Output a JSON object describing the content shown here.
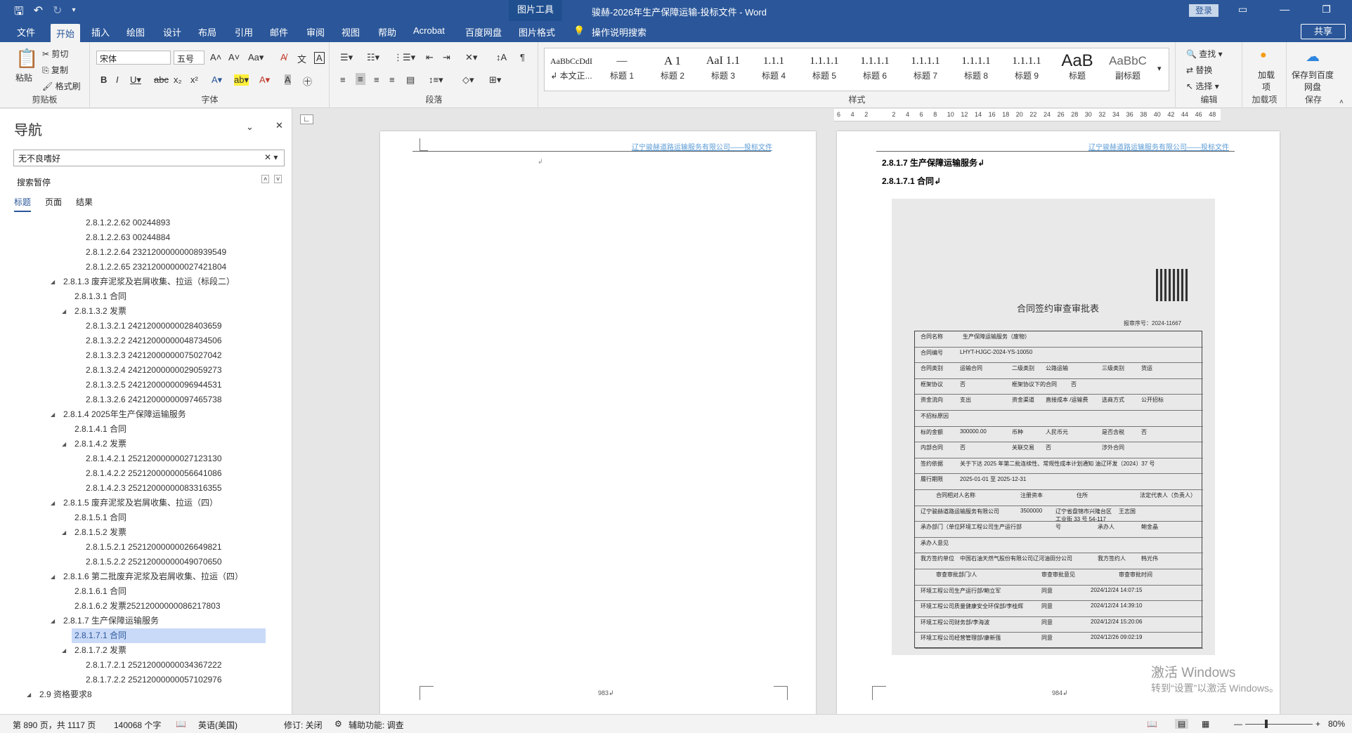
{
  "window": {
    "title": "骏赫-2026年生产保障运输-投标文件 - Word",
    "context_tab": "图片工具",
    "login": "登录"
  },
  "tabs": [
    "文件",
    "开始",
    "插入",
    "绘图",
    "设计",
    "布局",
    "引用",
    "邮件",
    "审阅",
    "视图",
    "帮助",
    "Acrobat",
    "百度网盘",
    "图片格式"
  ],
  "active_tab": "开始",
  "tell_me": "操作说明搜索",
  "share": "共享",
  "ribbon": {
    "clipboard": {
      "paste": "粘贴",
      "cut": "剪切",
      "copy": "复制",
      "format_painter": "格式刷",
      "label": "剪贴板"
    },
    "font": {
      "name": "宋体",
      "size": "五号",
      "label": "字体"
    },
    "paragraph": {
      "label": "段落"
    },
    "styles": {
      "label": "样式",
      "items": [
        {
          "sample": "AaBbCcDdI",
          "name": "↲ 本文正..."
        },
        {
          "sample": "—",
          "name": "标题 1"
        },
        {
          "sample": "A 1",
          "name": "标题 2"
        },
        {
          "sample": "AaI 1.1",
          "name": "标题 3"
        },
        {
          "sample": "1.1.1",
          "name": "标题 4"
        },
        {
          "sample": "1.1.1.1",
          "name": "标题 5"
        },
        {
          "sample": "1.1.1.1",
          "name": "标题 6"
        },
        {
          "sample": "1.1.1.1",
          "name": "标题 7"
        },
        {
          "sample": "1.1.1.1",
          "name": "标题 8"
        },
        {
          "sample": "1.1.1.1",
          "name": "标题 9"
        },
        {
          "sample": "AaB",
          "name": "标题"
        },
        {
          "sample": "AaBbC",
          "name": "副标题"
        }
      ]
    },
    "editing": {
      "find": "查找",
      "replace": "替换",
      "select": "选择",
      "label": "编辑"
    },
    "addins": {
      "btn": "加载项",
      "label": "加载项"
    },
    "save": {
      "btn": "保存到百度网盘",
      "label": "保存"
    }
  },
  "nav": {
    "title": "导航",
    "search": "无不良嗜好",
    "status": "搜索暂停",
    "tabs": [
      "标题",
      "页面",
      "结果"
    ],
    "items": [
      {
        "t": "2.8.1.2.2.62 00244893",
        "l": 4
      },
      {
        "t": "2.8.1.2.2.63 00244884",
        "l": 4
      },
      {
        "t": "2.8.1.2.2.64 23212000000008939549",
        "l": 4
      },
      {
        "t": "2.8.1.2.2.65 23212000000027421804",
        "l": 4
      },
      {
        "t": "2.8.1.3 废弃泥浆及岩屑收集、拉运（标段二）",
        "l": 2,
        "x": true
      },
      {
        "t": "2.8.1.3.1 合同",
        "l": 3
      },
      {
        "t": "2.8.1.3.2 发票",
        "l": 3,
        "x": true
      },
      {
        "t": "2.8.1.3.2.1 24212000000028403659",
        "l": 4
      },
      {
        "t": "2.8.1.3.2.2 24212000000048734506",
        "l": 4
      },
      {
        "t": "2.8.1.3.2.3 24212000000075027042",
        "l": 4
      },
      {
        "t": "2.8.1.3.2.4 24212000000029059273",
        "l": 4
      },
      {
        "t": "2.8.1.3.2.5 24212000000096944531",
        "l": 4
      },
      {
        "t": "2.8.1.3.2.6 24212000000097465738",
        "l": 4
      },
      {
        "t": "2.8.1.4 2025年生产保障运输服务",
        "l": 2,
        "x": true
      },
      {
        "t": "2.8.1.4.1 合同",
        "l": 3
      },
      {
        "t": "2.8.1.4.2 发票",
        "l": 3,
        "x": true
      },
      {
        "t": "2.8.1.4.2.1 25212000000027123130",
        "l": 4
      },
      {
        "t": "2.8.1.4.2.2 25212000000056641086",
        "l": 4
      },
      {
        "t": "2.8.1.4.2.3 25212000000083316355",
        "l": 4
      },
      {
        "t": "2.8.1.5 废弃泥浆及岩屑收集、拉运（四）",
        "l": 2,
        "x": true
      },
      {
        "t": "2.8.1.5.1 合同",
        "l": 3
      },
      {
        "t": "2.8.1.5.2 发票",
        "l": 3,
        "x": true
      },
      {
        "t": "2.8.1.5.2.1 25212000000026649821",
        "l": 4
      },
      {
        "t": "2.8.1.5.2.2 25212000000049070650",
        "l": 4
      },
      {
        "t": "2.8.1.6 第二批废弃泥浆及岩屑收集、拉运（四）",
        "l": 2,
        "x": true
      },
      {
        "t": "2.8.1.6.1 合同",
        "l": 3
      },
      {
        "t": "2.8.1.6.2 发票25212000000086217803",
        "l": 3
      },
      {
        "t": "2.8.1.7 生产保障运输服务",
        "l": 2,
        "x": true
      },
      {
        "t": "2.8.1.7.1 合同",
        "l": 3,
        "sel": true
      },
      {
        "t": "2.8.1.7.2 发票",
        "l": 3,
        "x": true
      },
      {
        "t": "2.8.1.7.2.1 25212000000034367222",
        "l": 4
      },
      {
        "t": "2.8.1.7.2.2 25212000000057102976",
        "l": 4
      },
      {
        "t": "2.9 资格要求8",
        "l": 1,
        "x": true
      }
    ]
  },
  "pages": {
    "header_text": "辽宁骏赫道路运输服务有限公司——投标文件",
    "left_no": "983↲",
    "right_no": "984↲",
    "h1": "2.8.1.7 生产保障运输服务↲",
    "h2": "2.8.1.7.1 合同↲"
  },
  "ruler_ticks": [
    "6",
    "4",
    "2",
    "",
    "2",
    "4",
    "6",
    "8",
    "10",
    "12",
    "14",
    "16",
    "18",
    "20",
    "22",
    "24",
    "26",
    "28",
    "30",
    "32",
    "34",
    "36",
    "38",
    "40",
    "42",
    "44",
    "46",
    "48"
  ],
  "scan": {
    "title": "合同签约审查审批表",
    "no": "报审序号：2024-11667",
    "rows": [
      [
        "合同名称",
        "生产保障运输服务（废物）"
      ],
      [
        "合同编号",
        "LHYT-HJGC-2024-YS-10050"
      ],
      [
        "合同类别",
        "运输合同",
        "二级类别",
        "公路运输",
        "三级类别",
        "货运"
      ],
      [
        "框架协议",
        "否",
        "框架协议下的合同",
        "否"
      ],
      [
        "资金流向",
        "支出",
        "资金渠道",
        "直接成本 /运输费",
        "选商方式",
        "公开招标"
      ],
      [
        "不招标原因",
        ""
      ],
      [
        "标的金额",
        "300000.00",
        "币种",
        "人民币元",
        "是否含税",
        "否"
      ],
      [
        "内部合同",
        "否",
        "关联交易",
        "否",
        "涉外合同",
        ""
      ],
      [
        "签约依据",
        "关于下达 2025 年第二批连续性、常规性成本计划通知 油辽环发〔2024〕37 号"
      ],
      [
        "履行期限",
        "2025-01-01 至 2025-12-31"
      ],
      [
        "合同相对人名称",
        "注册资本",
        "住所",
        "法定代表人（负责人）"
      ],
      [
        "辽宁骏赫道路运输服务有限公司",
        "3500000",
        "辽宁省盘锦市兴隆台区工业街 33 号 54-117 号",
        "王志国"
      ],
      [
        "承办部门（单位）",
        "环境工程公司生产运行部",
        "承办人",
        "鲍金晶"
      ],
      [
        "承办人意见",
        ""
      ],
      [
        "我方签约单位",
        "中国石油天然气股份有限公司辽河油田分公司",
        "我方签约人",
        "韩光伟"
      ],
      [
        "审查审批部门/人",
        "审查审批意见",
        "审查审批时间"
      ],
      [
        "环境工程公司生产运行部/鲍立军",
        "同意",
        "2024/12/24 14:07:15"
      ],
      [
        "环境工程公司质量健康安全环保部/李桂辉",
        "同意",
        "2024/12/24 14:39:10"
      ],
      [
        "环境工程公司财务部/李海波",
        "同意",
        "2024/12/24 15:20:06"
      ],
      [
        "环境工程公司经营管理部/康新强",
        "同意",
        "2024/12/26 09:02:19"
      ]
    ]
  },
  "status": {
    "page": "第 890 页，共 1117 页",
    "words": "140068 个字",
    "lang": "英语(美国)",
    "track": "修订: 关闭",
    "access": "辅助功能: 调查",
    "zoom": "80%"
  },
  "watermark": {
    "line1": "激活 Windows",
    "line2": "转到“设置”以激活 Windows。"
  }
}
